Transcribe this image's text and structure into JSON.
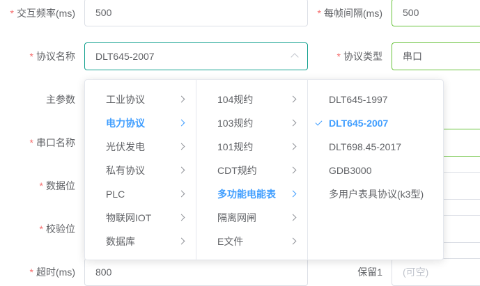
{
  "form": {
    "interaction_freq": {
      "label": "交互频率(ms)",
      "value": "500"
    },
    "frame_interval": {
      "label": "每帧间隔(ms)",
      "value": "500"
    },
    "protocol_name": {
      "label": "协议名称",
      "value": "DLT645-2007"
    },
    "protocol_type": {
      "label": "协议类型",
      "value": "串口"
    },
    "main_param": {
      "label": "主参数"
    },
    "serial_name": {
      "label": "串口名称"
    },
    "data_bits": {
      "label": "数据位"
    },
    "parity": {
      "label": "校验位"
    },
    "timeout": {
      "label": "超时(ms)",
      "value": "800"
    },
    "reserved1": {
      "label": "保留1",
      "placeholder": "(可空)"
    },
    "required_mark": "*"
  },
  "cascader": {
    "col1": [
      "工业协议",
      "电力协议",
      "光伏发电",
      "私有协议",
      "PLC",
      "物联网IOT",
      "数据库"
    ],
    "col1_active": "电力协议",
    "col2": [
      "104规约",
      "103规约",
      "101规约",
      "CDT规约",
      "多功能电能表",
      "隔离网闸",
      "E文件"
    ],
    "col2_active": "多功能电能表",
    "col3": [
      "DLT645-1997",
      "DLT645-2007",
      "DLT698.45-2017",
      "GDB3000",
      "多用户表具协议(k3型)"
    ],
    "col3_selected": "DLT645-2007"
  },
  "colors": {
    "accent": "#409eff",
    "required": "#f56c6c",
    "success_border": "#67c23a",
    "focus_border": "#13a18f"
  }
}
